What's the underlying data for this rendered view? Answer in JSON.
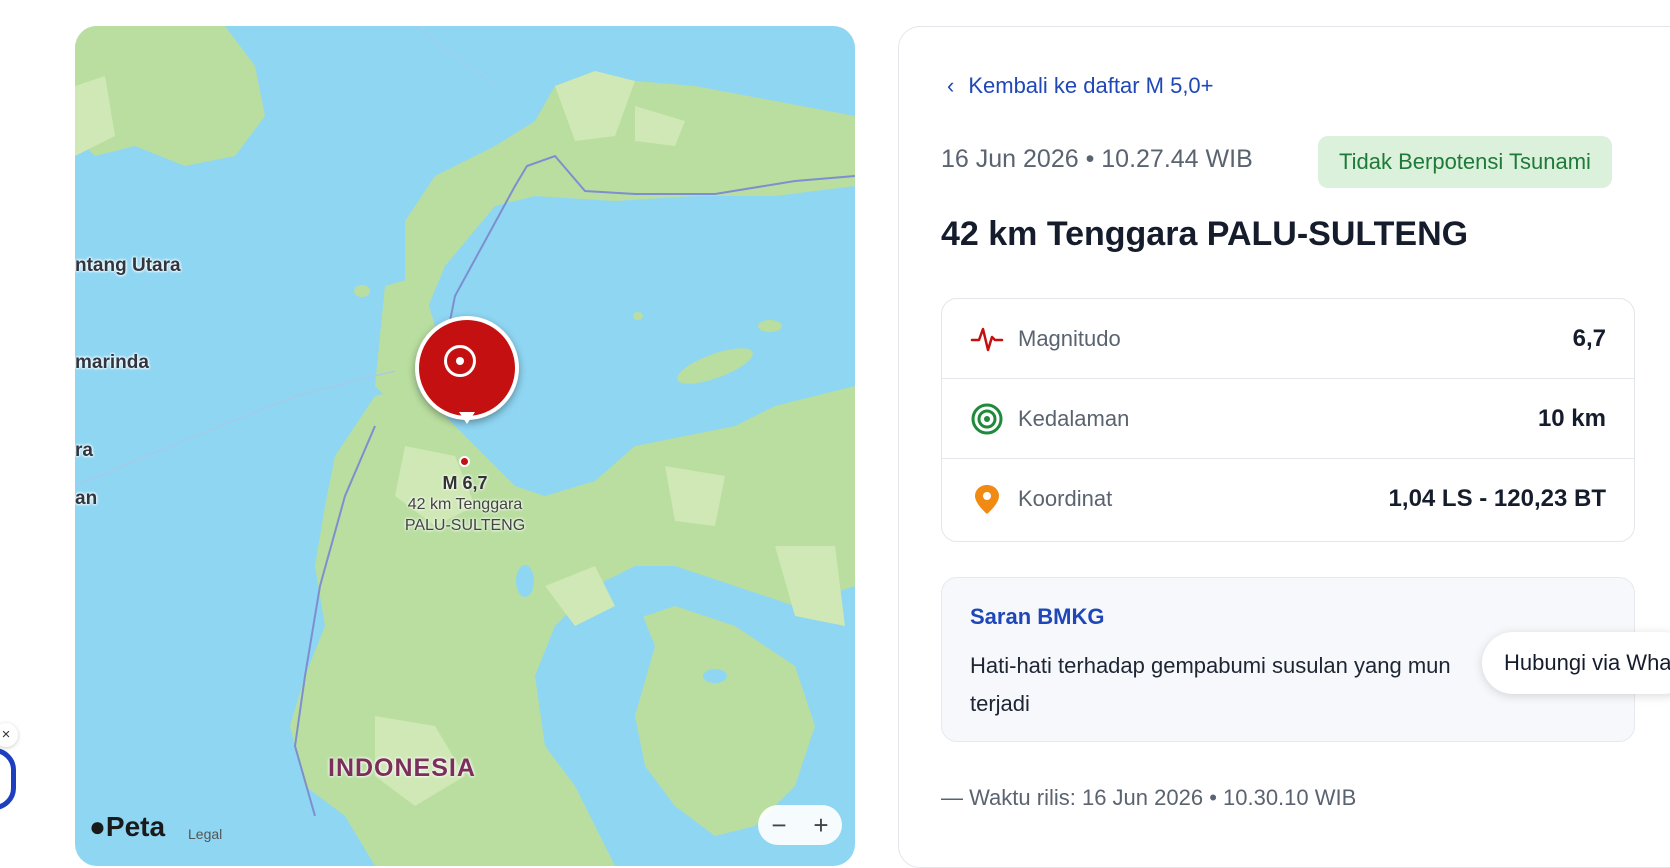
{
  "map": {
    "place_labels": [
      "ntang Utara",
      "marinda",
      "ra",
      "an"
    ],
    "country_label": "INDONESIA",
    "marker": {
      "magnitude_label": "M 6,7",
      "place_line1": "42 km Tenggara",
      "place_line2": "PALU-SULTENG"
    },
    "brand": "Peta",
    "legal": "Legal",
    "zoom_out": "−",
    "zoom_in": "+",
    "close_glyph": "×",
    "colors": {
      "water": "#8fd6f2",
      "land": "#b9dea0",
      "marker": "#c41010"
    }
  },
  "panel": {
    "back_link": "Kembali ke daftar M 5,0+",
    "time": "16 Jun 2026 • 10.27.44 WIB",
    "tsunami_badge": "Tidak Berpotensi Tsunami",
    "title": "42 km Tenggara PALU-SULTENG",
    "info": [
      {
        "icon": "pulse-icon",
        "label": "Magnitudo",
        "value": "6,7"
      },
      {
        "icon": "target-icon",
        "label": "Kedalaman",
        "value": "10 km"
      },
      {
        "icon": "location-pin-icon",
        "label": "Koordinat",
        "value": "1,04 LS - 120,23 BT"
      }
    ],
    "advice": {
      "title": "Saran BMKG",
      "text": "Hati-hati terhadap gempabumi susulan yang mun terjadi"
    },
    "release": "— Waktu rilis: 16 Jun 2026 • 10.30.10 WIB",
    "colors": {
      "accent": "#1f47b8",
      "badge_bg": "#dbf1dc",
      "badge_text": "#1f7a3a"
    }
  },
  "floating": {
    "whatsapp_label": "Hubungi via Wha"
  }
}
